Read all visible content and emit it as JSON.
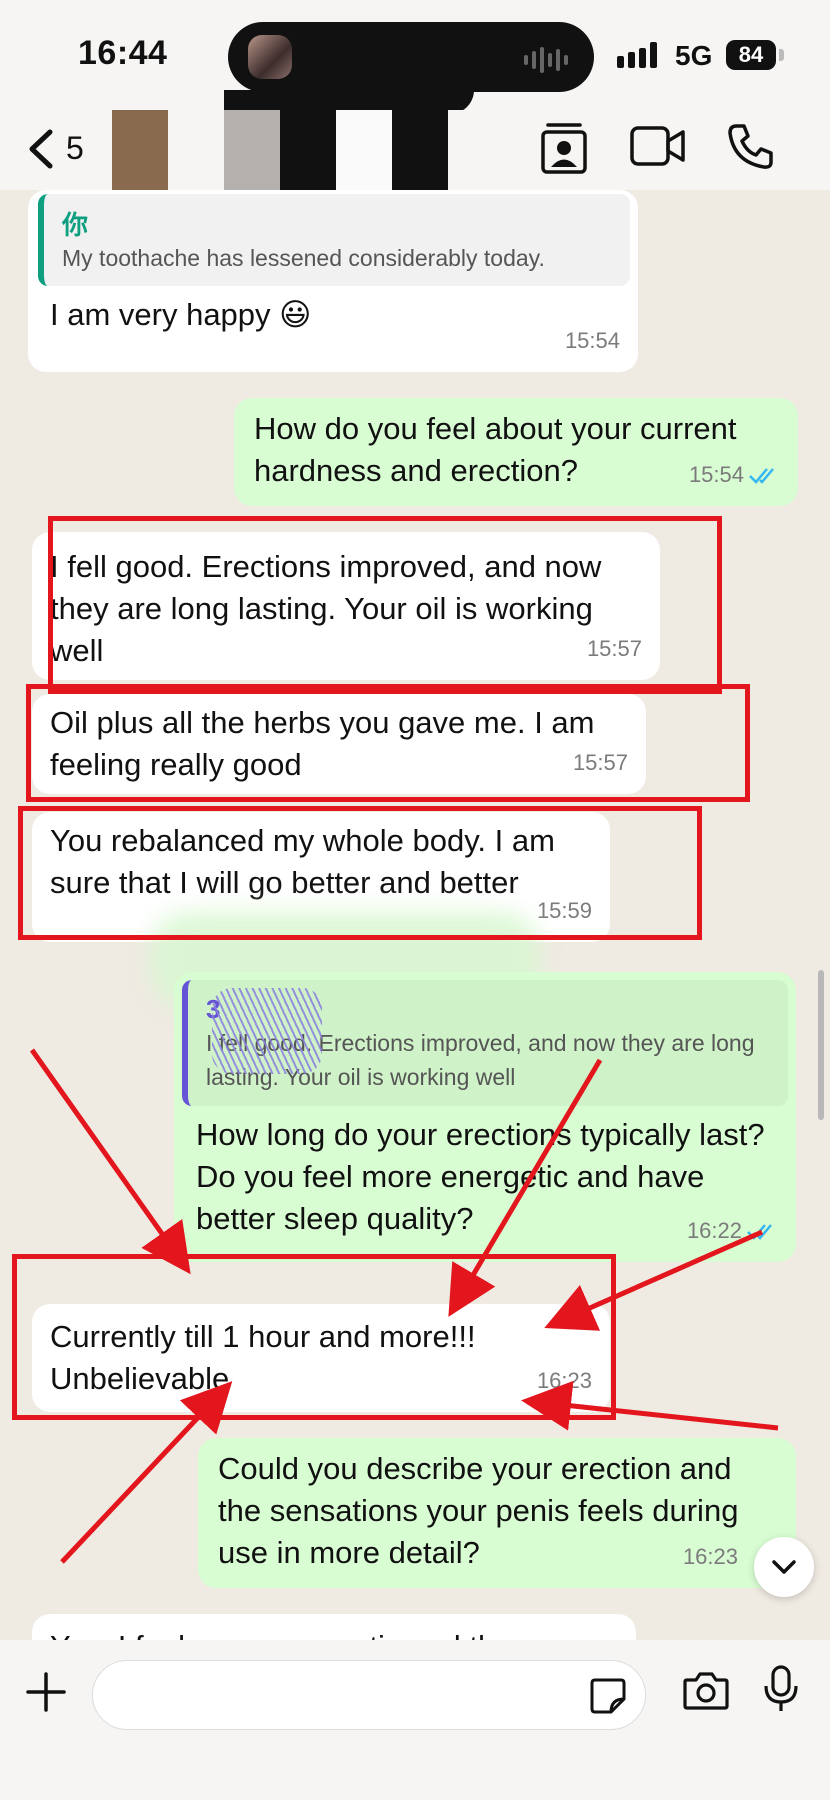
{
  "status_bar": {
    "time": "16:44",
    "network": "5G",
    "battery": "84"
  },
  "header": {
    "back_count": "5"
  },
  "messages": [
    {
      "quote_name": "你",
      "quote_text": "My toothache has lessened considerably today.",
      "text": "I am very happy 😃",
      "time": "15:54"
    },
    {
      "text": "How do you feel about your current hardness and erection?",
      "time": "15:54"
    },
    {
      "text": "I fell good. Erections improved, and now they are long lasting. Your oil is working well",
      "time": "15:57"
    },
    {
      "text": "Oil plus all the herbs you gave me. I am feeling really good",
      "time": "15:57"
    },
    {
      "text": "You rebalanced my whole body. I am sure that I will go better and better",
      "time": "15:59"
    },
    {
      "quote_name": "3",
      "quote_text": "I fell good. Erections improved, and now they are long lasting. Your oil is working well",
      "text": "How long do your erections typically last? Do you feel more energetic and have better sleep quality?",
      "time": "16:22"
    },
    {
      "text": "Currently till 1 hour and more!!! Unbelievable",
      "time": "16:23"
    },
    {
      "text": "Could you describe your erection and the sensations your penis feels during use in more detail?",
      "time": "16:23"
    },
    {
      "text": "Yes. I feel more energetic and the"
    }
  ],
  "icons": {
    "back": "chevron-left-icon",
    "contact_card": "contact-card-icon",
    "video": "video-camera-icon",
    "phone": "phone-icon",
    "read_receipt": "double-check-icon",
    "scroll_down": "chevron-down-icon",
    "plus": "plus-icon",
    "sticker": "sticker-icon",
    "camera": "camera-icon",
    "mic": "microphone-icon"
  },
  "colors": {
    "background": "#efeae2",
    "incoming_bubble": "#ffffff",
    "outgoing_bubble": "#d9fdd3",
    "annotation_red": "#e3151d",
    "read_tick": "#34b7f1",
    "quote_accent_green": "#0e9f80",
    "quote_accent_purple": "#6555d6"
  }
}
